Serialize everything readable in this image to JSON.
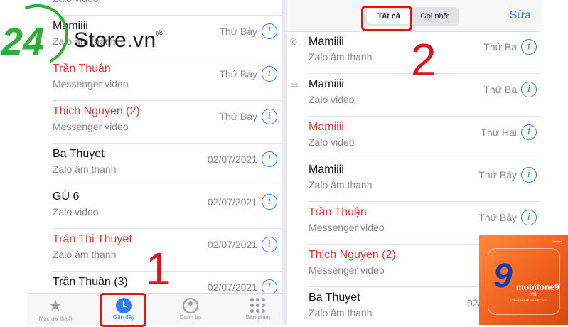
{
  "left_panel": {
    "rows": [
      {
        "name": "",
        "sub": "Zalo video",
        "date": "",
        "missed": false
      },
      {
        "name": "Mamiiii",
        "sub": "Zalo âm thanh",
        "date": "Thứ Bảy",
        "missed": false
      },
      {
        "name": "Trần Thuận",
        "sub": "Messenger video",
        "date": "Thứ Bảy",
        "missed": true
      },
      {
        "name": "Thich Nguyen (2)",
        "sub": "Messenger video",
        "date": "Thứ Bảy",
        "missed": true
      },
      {
        "name": "Ba Thuyet",
        "sub": "Zalo âm thanh",
        "date": "02/07/2021",
        "missed": false
      },
      {
        "name": "GÙ 6",
        "sub": "Zalo video",
        "date": "02/07/2021",
        "missed": false
      },
      {
        "name": "Trán Thi Thuyet",
        "sub": "Zalo âm thanh",
        "date": "02/07/2021",
        "missed": true
      },
      {
        "name": "Trần Thuận (3)",
        "sub": "",
        "date": "02/07/2021",
        "missed": false
      }
    ],
    "tabbar": {
      "favorites": "Mục ưa thích",
      "recents": "Gần đây",
      "contacts": "Danh bạ",
      "keypad": "Bàn phím"
    }
  },
  "right_panel": {
    "segment": {
      "all": "Tất cả",
      "missed": "Gọi nhỡ"
    },
    "edit": "Sửa",
    "rows": [
      {
        "name": "Mamiiii",
        "sub": "Zalo âm thanh",
        "date": "Thứ Ba",
        "missed": false,
        "icon": "phone-icon"
      },
      {
        "name": "Mamiiii",
        "sub": "Zalo video",
        "date": "Thứ Ba",
        "missed": false,
        "icon": "video-icon"
      },
      {
        "name": "Mamiiii",
        "sub": "Zalo video",
        "date": "Thứ Hai",
        "missed": true,
        "icon": ""
      },
      {
        "name": "Mamiiii",
        "sub": "Zalo âm thanh",
        "date": "Thứ Bảy",
        "missed": false,
        "icon": ""
      },
      {
        "name": "Trần Thuận",
        "sub": "Messenger video",
        "date": "Thứ Bảy",
        "missed": true,
        "icon": ""
      },
      {
        "name": "Thich Nguyen (2)",
        "sub": "Messenger video",
        "date": "Thứ Bảy",
        "missed": true,
        "icon": ""
      },
      {
        "name": "Ba Thuyet",
        "sub": "Zalo âm thanh",
        "date": "02/07/2021",
        "missed": false,
        "icon": ""
      }
    ]
  },
  "annotations": {
    "step1": "1",
    "step2": "2"
  },
  "watermark_logo": {
    "number": "24",
    "text": "Store.vn",
    "reg": "®"
  },
  "badge": {
    "brand": "mobifone9",
    "domain": ".vn",
    "tagline": "CÔNG NGHỆ VÀ KẾT NỐI"
  },
  "colors": {
    "accent": "#2f7df6",
    "missed": "#e23a31",
    "highlight": "#e0141e"
  }
}
